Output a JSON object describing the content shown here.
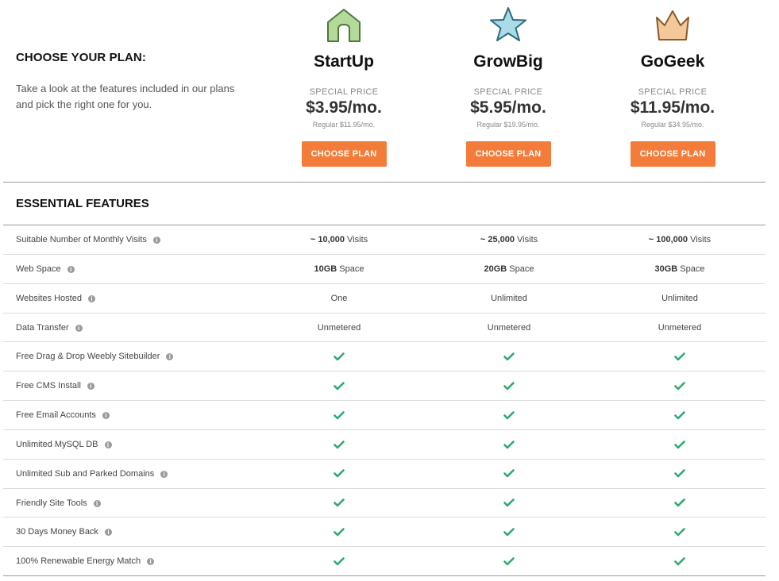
{
  "intro": {
    "title": "CHOOSE YOUR PLAN:",
    "text": "Take a look at the features included in our plans and pick the right one for you."
  },
  "plans": [
    {
      "name": "StartUp",
      "icon": "house-icon",
      "icon_color": "#b5d89b",
      "special": "SPECIAL PRICE",
      "price": "$3.95/mo.",
      "regular": "Regular $11.95/mo.",
      "button": "CHOOSE PLAN"
    },
    {
      "name": "GrowBig",
      "icon": "star-icon",
      "icon_color": "#a9dce8",
      "special": "SPECIAL PRICE",
      "price": "$5.95/mo.",
      "regular": "Regular $19.95/mo.",
      "button": "CHOOSE PLAN"
    },
    {
      "name": "GoGeek",
      "icon": "crown-icon",
      "icon_color": "#f3c99a",
      "special": "SPECIAL PRICE",
      "price": "$11.95/mo.",
      "regular": "Regular $34.95/mo.",
      "button": "CHOOSE PLAN"
    }
  ],
  "section": {
    "title": "ESSENTIAL FEATURES"
  },
  "features": [
    {
      "label": "Suitable Number of Monthly Visits",
      "values": [
        {
          "bold": "~ 10,000",
          "rest": " Visits"
        },
        {
          "bold": "~ 25,000",
          "rest": " Visits"
        },
        {
          "bold": "~ 100,000",
          "rest": " Visits"
        }
      ]
    },
    {
      "label": "Web Space",
      "values": [
        {
          "bold": "10GB",
          "rest": " Space"
        },
        {
          "bold": "20GB",
          "rest": " Space"
        },
        {
          "bold": "30GB",
          "rest": " Space"
        }
      ]
    },
    {
      "label": "Websites Hosted",
      "values": [
        {
          "text": "One"
        },
        {
          "text": "Unlimited"
        },
        {
          "text": "Unlimited"
        }
      ]
    },
    {
      "label": "Data Transfer",
      "values": [
        {
          "text": "Unmetered"
        },
        {
          "text": "Unmetered"
        },
        {
          "text": "Unmetered"
        }
      ]
    },
    {
      "label": "Free Drag & Drop Weebly Sitebuilder",
      "values": [
        {
          "check": true
        },
        {
          "check": true
        },
        {
          "check": true
        }
      ]
    },
    {
      "label": "Free CMS Install",
      "values": [
        {
          "check": true
        },
        {
          "check": true
        },
        {
          "check": true
        }
      ]
    },
    {
      "label": "Free Email Accounts",
      "values": [
        {
          "check": true
        },
        {
          "check": true
        },
        {
          "check": true
        }
      ]
    },
    {
      "label": "Unlimited MySQL DB",
      "values": [
        {
          "check": true
        },
        {
          "check": true
        },
        {
          "check": true
        }
      ]
    },
    {
      "label": "Unlimited Sub and Parked Domains",
      "values": [
        {
          "check": true
        },
        {
          "check": true
        },
        {
          "check": true
        }
      ]
    },
    {
      "label": "Friendly Site Tools",
      "values": [
        {
          "check": true
        },
        {
          "check": true
        },
        {
          "check": true
        }
      ]
    },
    {
      "label": "30 Days Money Back",
      "values": [
        {
          "check": true
        },
        {
          "check": true
        },
        {
          "check": true
        }
      ]
    },
    {
      "label": "100% Renewable Energy Match",
      "values": [
        {
          "check": true
        },
        {
          "check": true
        },
        {
          "check": true
        }
      ]
    }
  ],
  "colors": {
    "accent": "#f37c3a",
    "check": "#2eaa72",
    "info_icon": "#9a9a9a"
  }
}
